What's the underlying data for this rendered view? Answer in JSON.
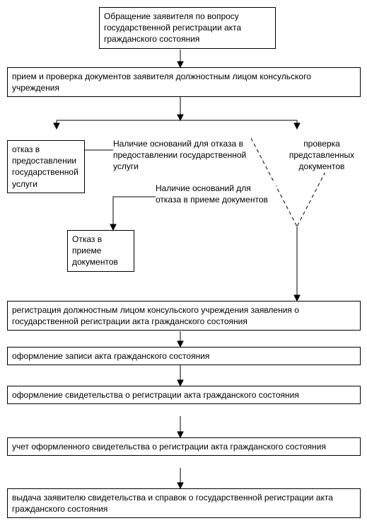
{
  "boxes": {
    "b1": "Обращение заявителя по вопросу государственной регистрации акта гражданского состояния",
    "b2": "прием и проверка документов заявителя должностным лицом консульского учреждения",
    "b3": "отказ в предоставлении государственной услуги",
    "b4": "Отказ в приеме документов",
    "b5": "регистрация должностным лицом консульского учреждения заявления о государственной регистрации акта гражданского состояния",
    "b6": "оформление записи акта гражданского состояния",
    "b7": "оформление свидетельства о регистрации акта гражданского состояния",
    "b8": "учет оформленного свидетельства о регистрации акта гражданского состояния",
    "b9": "выдача заявителю свидетельства и справок о государственной регистрации акта гражданского состояния"
  },
  "labels": {
    "l1": "Наличие оснований для отказа в предоставлении государственной услуги",
    "l2": "Наличие оснований для отказа в приеме документов",
    "l3": "проверка представленных документов"
  }
}
